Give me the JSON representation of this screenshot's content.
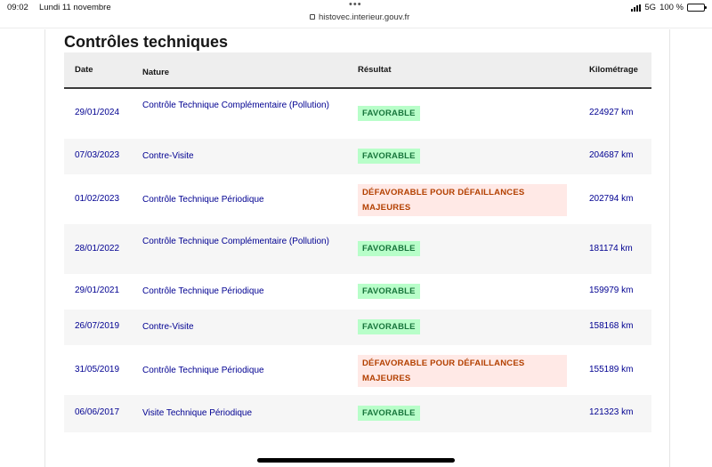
{
  "status_bar": {
    "time": "09:02",
    "date": "Lundi 11 novembre",
    "url": "histovec.interieur.gouv.fr",
    "network": "5G",
    "battery": "100 %"
  },
  "section": {
    "title": "Contrôles techniques"
  },
  "table": {
    "headers": {
      "date": "Date",
      "nature": "Nature",
      "result": "Résultat",
      "mileage": "Kilométrage"
    },
    "rows": [
      {
        "date": "29/01/2024",
        "nature": "Contrôle Technique Complémentaire (Pollution)",
        "result": "FAVORABLE",
        "status": "ok",
        "mileage": "224927 km"
      },
      {
        "date": "07/03/2023",
        "nature": "Contre-Visite",
        "result": "FAVORABLE",
        "status": "ok",
        "mileage": "204687 km"
      },
      {
        "date": "01/02/2023",
        "nature": "Contrôle Technique Périodique",
        "result": "DÉFAVORABLE POUR DÉFAILLANCES MAJEURES",
        "status": "bad",
        "mileage": "202794 km"
      },
      {
        "date": "28/01/2022",
        "nature": "Contrôle Technique Complémentaire (Pollution)",
        "result": "FAVORABLE",
        "status": "ok",
        "mileage": "181174 km"
      },
      {
        "date": "29/01/2021",
        "nature": "Contrôle Technique Périodique",
        "result": "FAVORABLE",
        "status": "ok",
        "mileage": "159979 km"
      },
      {
        "date": "26/07/2019",
        "nature": "Contre-Visite",
        "result": "FAVORABLE",
        "status": "ok",
        "mileage": "158168 km"
      },
      {
        "date": "31/05/2019",
        "nature": "Contrôle Technique Périodique",
        "result": "DÉFAVORABLE POUR DÉFAILLANCES MAJEURES",
        "status": "bad",
        "mileage": "155189 km"
      },
      {
        "date": "06/06/2017",
        "nature": "Visite Technique Périodique",
        "result": "FAVORABLE",
        "status": "ok",
        "mileage": "121323 km"
      }
    ]
  },
  "colors": {
    "link": "#000091",
    "favorable_bg": "#b8fec9",
    "favorable_text": "#18753c",
    "defavorable_bg": "#ffe9e6",
    "defavorable_text": "#b34000"
  }
}
